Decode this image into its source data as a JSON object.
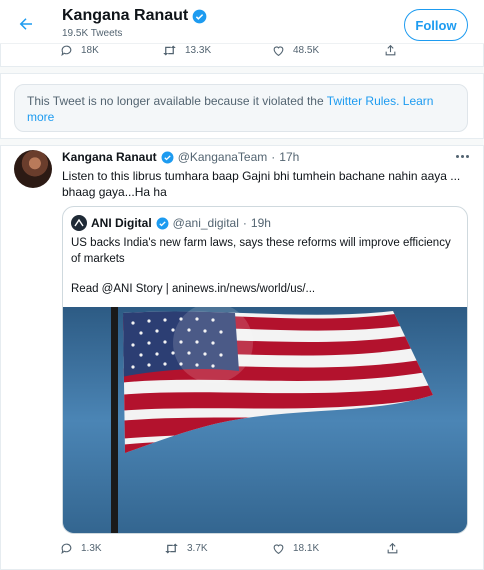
{
  "header": {
    "name": "Kangana Ranaut",
    "tweet_count": "19.5K Tweets",
    "follow_label": "Follow"
  },
  "top_tweet_actions": {
    "replies": "18K",
    "retweets": "13.3K",
    "likes": "48.5K"
  },
  "notice": {
    "text": "This Tweet is no longer available because it violated the ",
    "rules_link": "Twitter Rules.",
    "learn_more": "Learn more"
  },
  "tweet": {
    "name": "Kangana Ranaut",
    "handle": "@KanganaTeam",
    "separator": "·",
    "time": "17h",
    "text": "Listen to this librus tumhara baap Gajni bhi tumhein bachane nahin aaya ... bhaag gaya...Ha ha",
    "actions": {
      "replies": "1.3K",
      "retweets": "3.7K",
      "likes": "18.1K"
    }
  },
  "quoted": {
    "name": "ANI Digital",
    "handle": "@ani_digital",
    "separator": "·",
    "time": "19h",
    "text": "US backs India's new farm laws, says these reforms will improve efficiency of markets",
    "read_more": "Read @ANI Story | aninews.in/news/world/us/..."
  },
  "colors": {
    "accent": "#1d9bf0",
    "text": "#0f1419",
    "muted": "#536471"
  }
}
